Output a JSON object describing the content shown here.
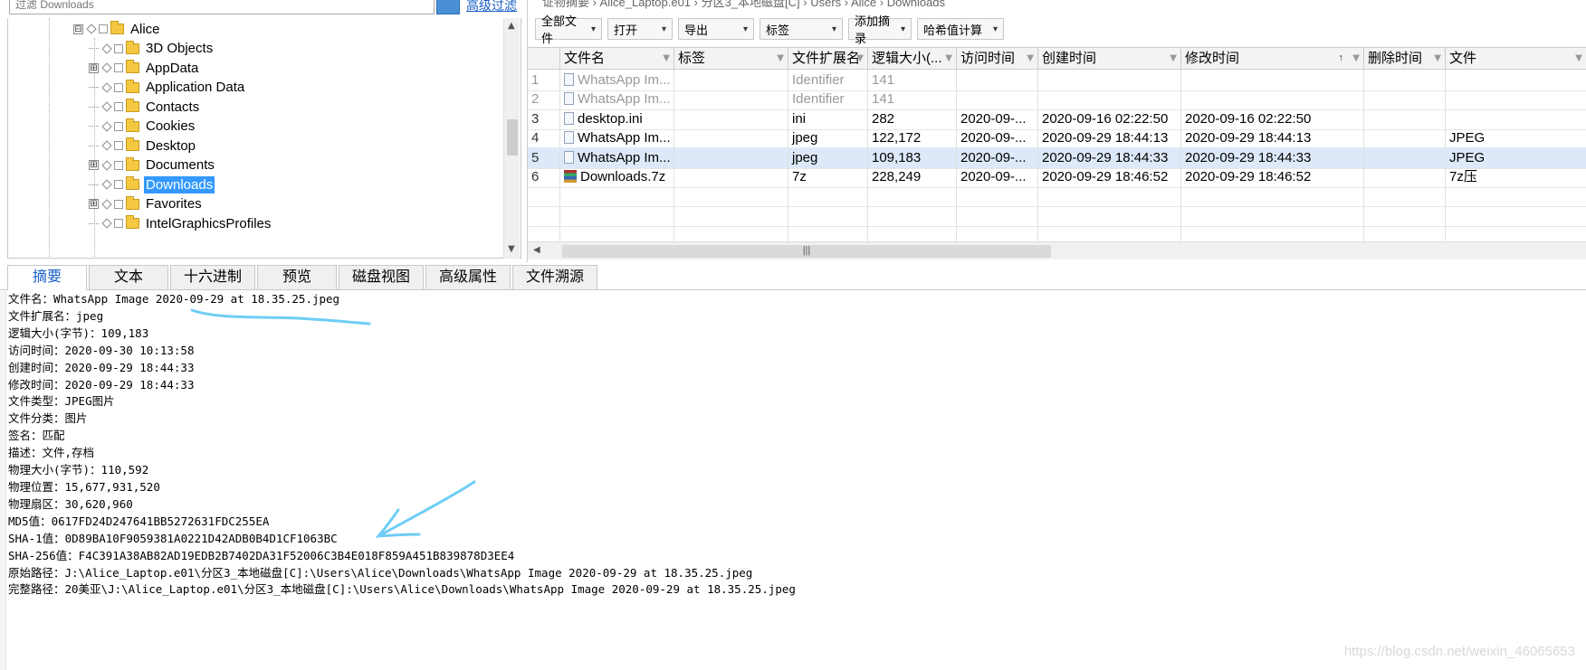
{
  "filter": {
    "placeholder": "过滤 Downloads",
    "advanced_label": "高级过滤"
  },
  "tree": {
    "items": [
      {
        "label": "Alice",
        "expander": "⊟"
      },
      {
        "label": "3D Objects",
        "expander": ""
      },
      {
        "label": "AppData",
        "expander": "⊞"
      },
      {
        "label": "Application Data",
        "expander": ""
      },
      {
        "label": "Contacts",
        "expander": ""
      },
      {
        "label": "Cookies",
        "expander": ""
      },
      {
        "label": "Desktop",
        "expander": ""
      },
      {
        "label": "Documents",
        "expander": "⊞"
      },
      {
        "label": "Downloads",
        "expander": "",
        "selected": true
      },
      {
        "label": "Favorites",
        "expander": "⊞"
      },
      {
        "label": "IntelGraphicsProfiles",
        "expander": ""
      }
    ]
  },
  "breadcrumb": "证物摘要  ›  Alice_Laptop.e01  ›  分区3_本地磁盘[C]  ›  Users  ›  Alice  ›  Downloads",
  "toolbar": {
    "buttons": [
      "全部文件",
      "打开",
      "导出",
      "标签",
      "添加摘录",
      "哈希值计算"
    ]
  },
  "grid": {
    "columns": [
      "文件名",
      "标签",
      "文件扩展名",
      "逻辑大小(...",
      "访问时间",
      "创建时间",
      "修改时间",
      "删除时间",
      "文件"
    ],
    "sort_indicator": "↑",
    "rows": [
      {
        "num": "1",
        "name": "WhatsApp Im...",
        "tag": "",
        "ext": "Identifier",
        "size": "141",
        "atime": "",
        "ctime": "",
        "mtime": "",
        "dtime": "",
        "type": "",
        "dim": true,
        "icon": "file"
      },
      {
        "num": "2",
        "name": "WhatsApp Im...",
        "tag": "",
        "ext": "Identifier",
        "size": "141",
        "atime": "",
        "ctime": "",
        "mtime": "",
        "dtime": "",
        "type": "",
        "dim": true,
        "icon": "file"
      },
      {
        "num": "3",
        "name": "desktop.ini",
        "tag": "",
        "ext": "ini",
        "size": "282",
        "atime": "2020-09-...",
        "ctime": "2020-09-16 02:22:50",
        "mtime": "2020-09-16 02:22:50",
        "dtime": "",
        "type": "",
        "icon": "file"
      },
      {
        "num": "4",
        "name": "WhatsApp Im...",
        "tag": "",
        "ext": "jpeg",
        "size": "122,172",
        "atime": "2020-09-...",
        "ctime": "2020-09-29 18:44:13",
        "mtime": "2020-09-29 18:44:13",
        "dtime": "",
        "type": "JPEG",
        "icon": "file"
      },
      {
        "num": "5",
        "name": "WhatsApp Im...",
        "tag": "",
        "ext": "jpeg",
        "size": "109,183",
        "atime": "2020-09-...",
        "ctime": "2020-09-29 18:44:33",
        "mtime": "2020-09-29 18:44:33",
        "dtime": "",
        "type": "JPEG",
        "icon": "file",
        "selected": true
      },
      {
        "num": "6",
        "name": "Downloads.7z",
        "tag": "",
        "ext": "7z",
        "size": "228,249",
        "atime": "2020-09-...",
        "ctime": "2020-09-29 18:46:52",
        "mtime": "2020-09-29 18:46:52",
        "dtime": "",
        "type": "7z压",
        "icon": "zip"
      }
    ],
    "scroll_grip": "|||"
  },
  "tabs": [
    "摘要",
    "文本",
    "十六进制",
    "预览",
    "磁盘视图",
    "高级属性",
    "文件溯源"
  ],
  "summary_lines": [
    "文件名：WhatsApp Image 2020-09-29 at 18.35.25.jpeg",
    "文件扩展名：jpeg",
    "逻辑大小(字节)：109,183",
    "访问时间：2020-09-30 10:13:58",
    "创建时间：2020-09-29 18:44:33",
    "修改时间：2020-09-29 18:44:33",
    "文件类型：JPEG图片",
    "文件分类：图片",
    "签名：匹配",
    "描述：文件,存档",
    "物理大小(字节)：110,592",
    "物理位置：15,677,931,520",
    "物理扇区：30,620,960",
    "MD5值：0617FD24D247641BB5272631FDC255EA",
    "SHA-1值：0D89BA10F9059381A0221D42ADB0B4D1CF1063BC",
    "SHA-256值：F4C391A38AB82AD19EDB2B7402DA31F52006C3B4E018F859A451B839878D3EE4",
    "原始路径：J:\\Alice_Laptop.e01\\分区3_本地磁盘[C]:\\Users\\Alice\\Downloads\\WhatsApp Image 2020-09-29 at 18.35.25.jpeg",
    "完整路径：20美亚\\J:\\Alice_Laptop.e01\\分区3_本地磁盘[C]:\\Users\\Alice\\Downloads\\WhatsApp Image 2020-09-29 at 18.35.25.jpeg"
  ],
  "watermark": "https://blog.csdn.net/weixin_46065653",
  "colors": {
    "accent": "#1a5fc8",
    "selection": "#3399ff",
    "row_selected": "#dde9f9",
    "annotation": "#5ec3f0"
  }
}
